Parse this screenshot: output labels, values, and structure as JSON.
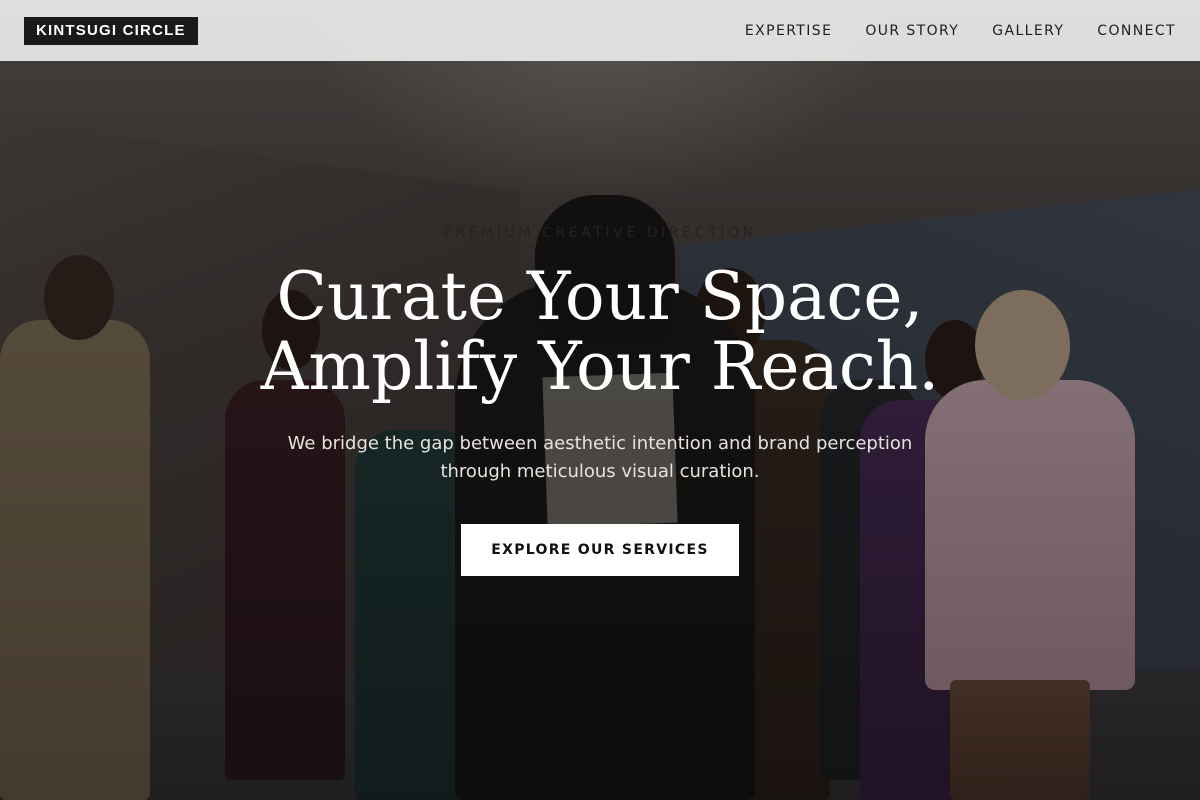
{
  "brand": {
    "name": "KINTSUGI CIRCLE"
  },
  "nav": {
    "items": [
      {
        "label": "EXPERTISE"
      },
      {
        "label": "OUR STORY"
      },
      {
        "label": "GALLERY"
      },
      {
        "label": "CONNECT"
      }
    ]
  },
  "hero": {
    "eyebrow": "PREMIUM CREATIVE DIRECTION",
    "headline_line1": "Curate Your Space,",
    "headline_line2": "Amplify Your Reach.",
    "subtext_line1": "We bridge the gap between aesthetic intention and brand perception",
    "subtext_line2": "through meticulous visual curation.",
    "cta_label": "EXPLORE OUR SERVICES"
  },
  "colors": {
    "header_bg": "#e8e8e8",
    "logo_bg": "#1a1a1a",
    "cta_bg": "#ffffff",
    "headline": "#ffffff"
  }
}
